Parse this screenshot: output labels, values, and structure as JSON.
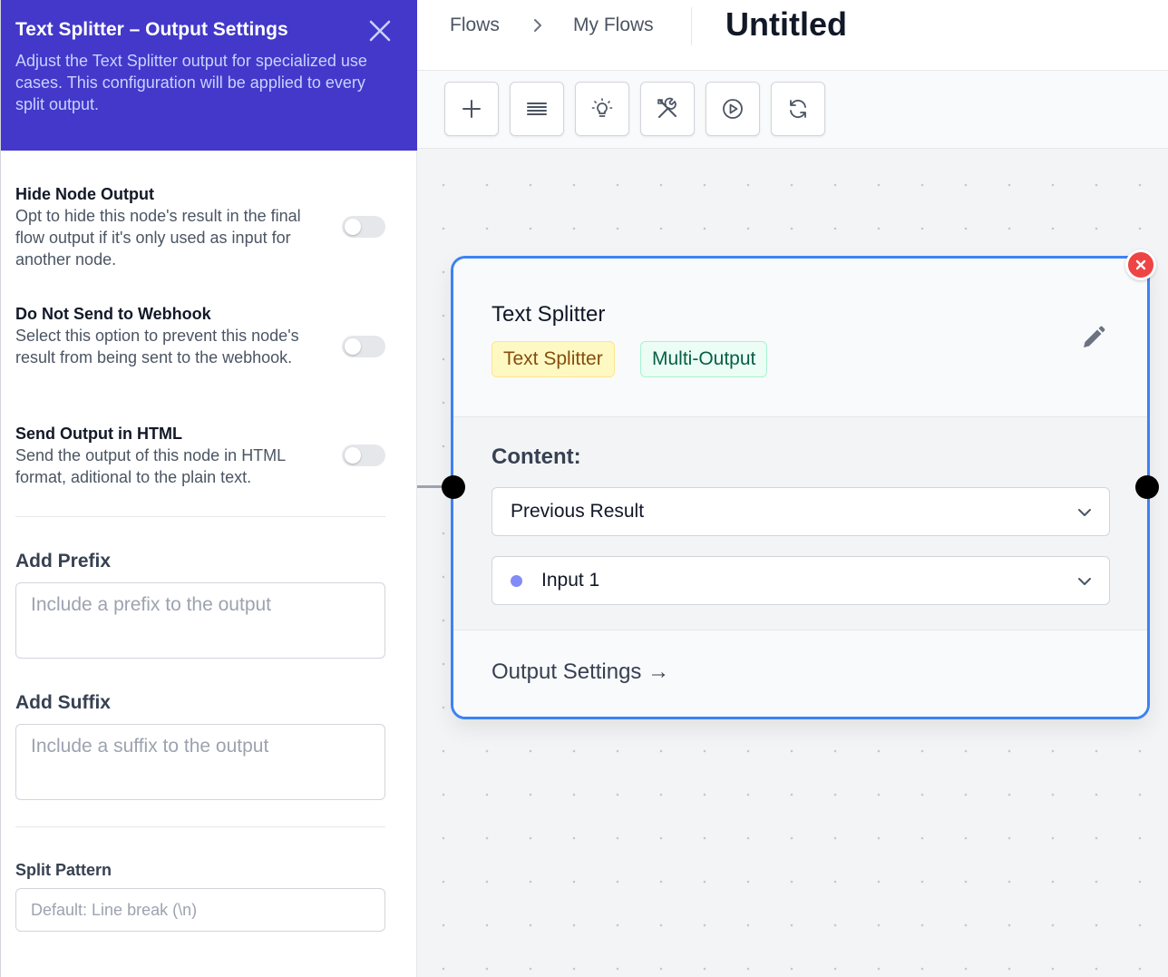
{
  "panel": {
    "title": "Text Splitter – Output Settings",
    "description": "Adjust the Text Splitter output for specialized use cases. This configuration will be applied to every split output.",
    "settings": [
      {
        "title": "Hide Node Output",
        "description": "Opt to hide this node's result in the final flow output if it's only used as input for another node.",
        "enabled": false
      },
      {
        "title": "Do Not Send to Webhook",
        "description": "Select this option to prevent this node's result from being sent to the webhook.",
        "enabled": false
      },
      {
        "title": "Send Output in HTML",
        "description": "Send the output of this node in HTML format, aditional to the plain text.",
        "enabled": false
      }
    ],
    "prefix": {
      "label": "Add Prefix",
      "placeholder": "Include a prefix to the output",
      "value": ""
    },
    "suffix": {
      "label": "Add Suffix",
      "placeholder": "Include a suffix to the output",
      "value": ""
    },
    "split_pattern": {
      "label": "Split Pattern",
      "placeholder": "Default: Line break (\\n)",
      "value": ""
    }
  },
  "breadcrumb": {
    "items": [
      "Flows",
      "My Flows"
    ],
    "title": "Untitled"
  },
  "toolbar": {
    "icons": [
      "plus-icon",
      "list-icon",
      "lightbulb-icon",
      "tools-icon",
      "play-icon",
      "refresh-icon"
    ]
  },
  "node": {
    "title": "Text Splitter",
    "tags": [
      "Text Splitter",
      "Multi-Output"
    ],
    "content_label": "Content:",
    "content_source": "Previous Result",
    "input_selection": "Input 1",
    "output_settings_link": "Output Settings →"
  },
  "colors": {
    "header_bg": "#4338ca",
    "node_border": "#3b82f6",
    "delete_button": "#ef4444",
    "input_dot": "#818cf8"
  }
}
